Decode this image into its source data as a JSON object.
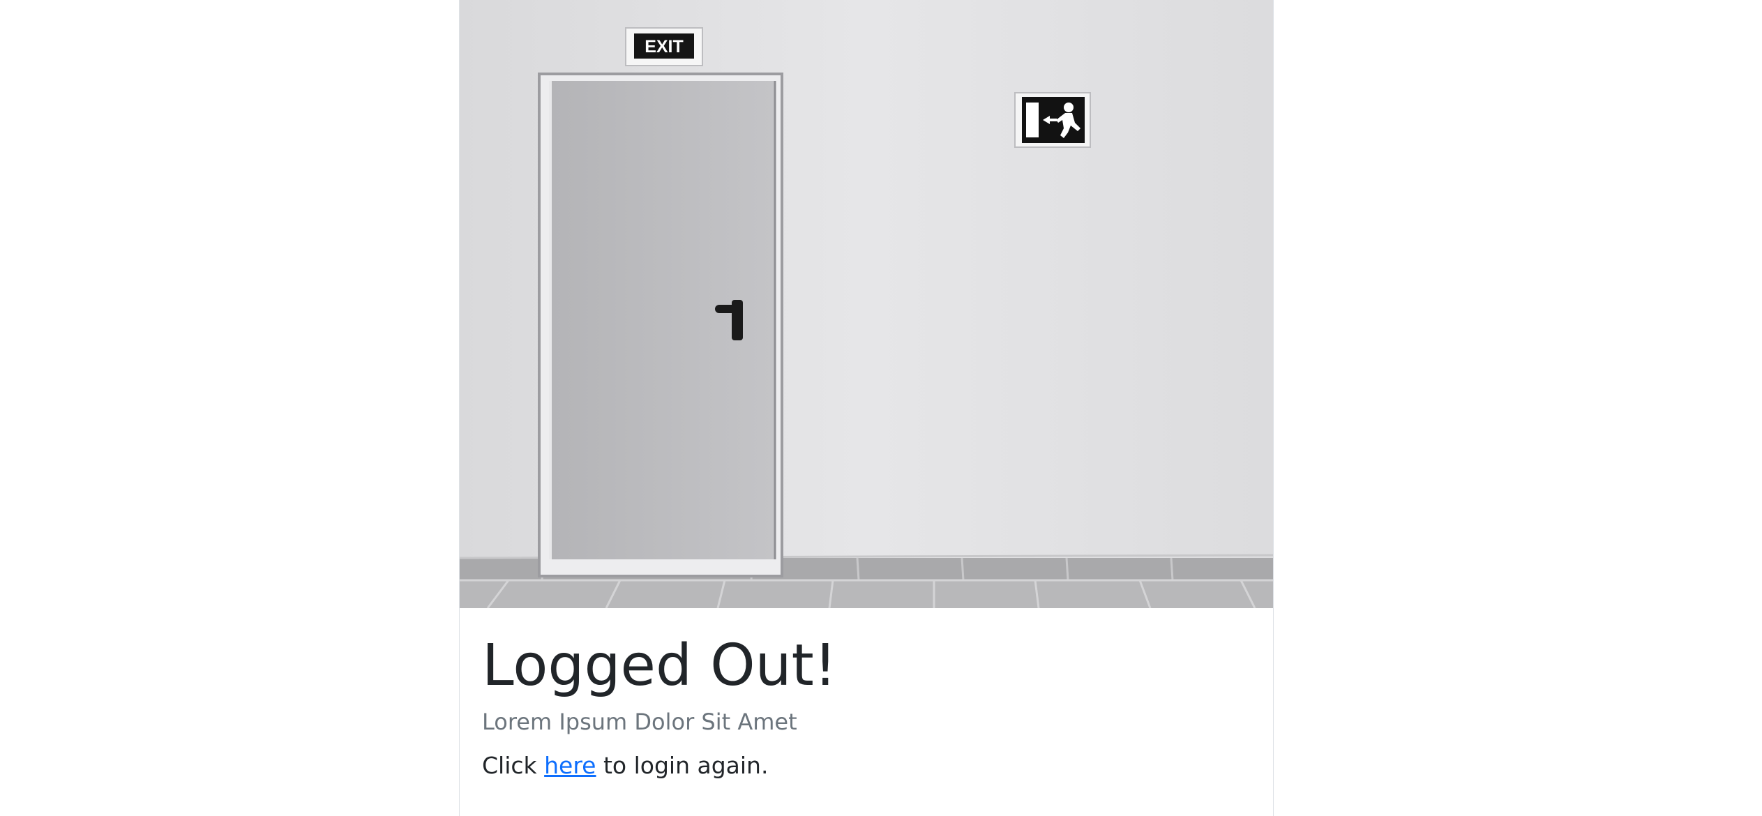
{
  "hero": {
    "exit_sign_text": "EXIT",
    "alt": ""
  },
  "card": {
    "title": "Logged Out!",
    "subtitle": "Lorem Ipsum Dolor Sit Amet",
    "text_before": "Click ",
    "link_text": "here",
    "text_after": " to login again."
  },
  "colors": {
    "link": "#0d6efd",
    "title": "#212529",
    "subtitle": "#6c757d"
  }
}
